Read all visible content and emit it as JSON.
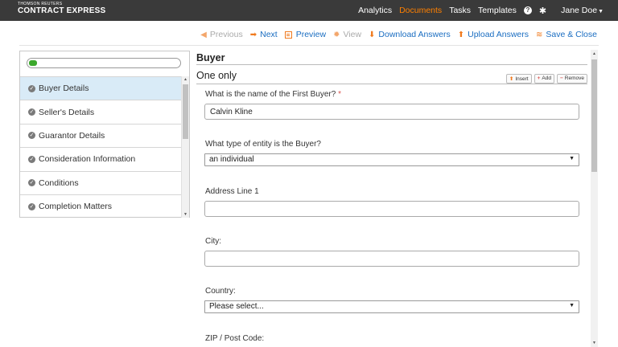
{
  "topbar": {
    "brand_small": "THOMSON REUTERS",
    "brand_big": "CONTRACT EXPRESS",
    "nav": [
      "Analytics",
      "Documents",
      "Tasks",
      "Templates"
    ],
    "active_nav": "Documents",
    "help_icon": "question-circle-icon",
    "settings_icon": "gear-icon",
    "user_name": "Jane Doe"
  },
  "toolbar": {
    "previous": "Previous",
    "next": "Next",
    "preview": "Preview",
    "view": "View",
    "download": "Download Answers",
    "upload": "Upload Answers",
    "save_close": "Save & Close"
  },
  "progress": {
    "fraction": 0.05,
    "color": "#3ba82c"
  },
  "sidebar": {
    "items": [
      {
        "label": "Buyer Details",
        "active": true
      },
      {
        "label": "Seller's Details",
        "active": false
      },
      {
        "label": "Guarantor Details",
        "active": false
      },
      {
        "label": "Consideration Information",
        "active": false
      },
      {
        "label": "Conditions",
        "active": false
      },
      {
        "label": "Completion Matters",
        "active": false
      }
    ]
  },
  "form": {
    "section_title": "Buyer",
    "group_title": "One only",
    "group_buttons": {
      "insert": "Insert",
      "add": "Add",
      "remove": "Remove"
    },
    "q1": {
      "label": "What is the name of the First Buyer?",
      "required_mark": "*",
      "value": "Calvin Kline"
    },
    "q2": {
      "label": "What type of entity is the Buyer?",
      "value": "an individual"
    },
    "q3": {
      "label": "Address Line 1",
      "value": ""
    },
    "q4": {
      "label": "City:",
      "value": ""
    },
    "q5": {
      "label": "Country:",
      "value": "Please select..."
    },
    "q6": {
      "label": "ZIP / Post Code:"
    }
  },
  "colors": {
    "accent": "#ff8000",
    "link": "#1a6dc1",
    "topbar": "#3a3a3a"
  }
}
